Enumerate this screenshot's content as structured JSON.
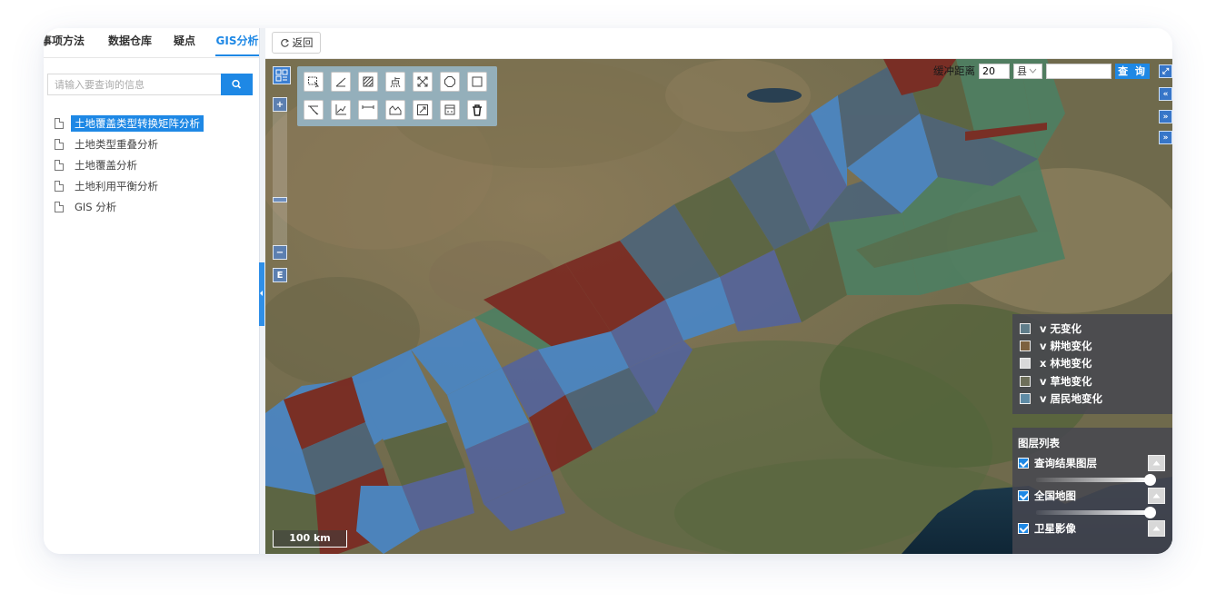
{
  "tabs": [
    {
      "label": "事项方法",
      "active": false
    },
    {
      "label": "数据仓库",
      "active": false
    },
    {
      "label": "疑点",
      "active": false
    },
    {
      "label": "GIS分析",
      "active": true
    }
  ],
  "search": {
    "placeholder": "请输入要查询的信息",
    "button_icon": "search-icon"
  },
  "tree": {
    "items": [
      {
        "label": "土地覆盖类型转换矩阵分析",
        "selected": true
      },
      {
        "label": "土地类型重叠分析",
        "selected": false
      },
      {
        "label": "土地覆盖分析",
        "selected": false
      },
      {
        "label": "土地利用平衡分析",
        "selected": false
      },
      {
        "label": "GIS 分析",
        "selected": false
      }
    ]
  },
  "topbar": {
    "back_label": "返回",
    "back_icon": "refresh-icon"
  },
  "map": {
    "buffer_label": "缓冲距离",
    "buffer_value": "20",
    "county_select": "县",
    "county_value": "",
    "query_label": "查 询",
    "scale_label": "100 km",
    "zoom_in": "+",
    "zoom_out": "−",
    "extent_label": "E",
    "side_buttons": [
      "⤢",
      "«",
      "»",
      "»"
    ],
    "tools": [
      "select-icon",
      "measure-line-icon",
      "hatch-area-icon",
      "point-tool-icon",
      "fit-extent-icon",
      "polygon-icon",
      "rectangle-icon",
      "clear-line-icon",
      "chart-axis-icon",
      "measure-distance-icon",
      "area-profile-icon",
      "zoom-frame-icon",
      "print-icon",
      "delete-icon"
    ],
    "point_tool_label": "点"
  },
  "legend": {
    "items": [
      {
        "label": "v 无变化",
        "color": "#5f7d8a"
      },
      {
        "label": "v 耕地变化",
        "color": "#7d6140"
      },
      {
        "label": "x 林地变化",
        "color": "#d9d9d9"
      },
      {
        "label": "v 草地变化",
        "color": "#6e6f5a"
      },
      {
        "label": "v 居民地变化",
        "color": "#5e8ba5"
      }
    ]
  },
  "layers": {
    "title": "图层列表",
    "items": [
      {
        "label": "查询结果图层",
        "checked": true,
        "opacity": 1.0
      },
      {
        "label": "全国地图",
        "checked": true,
        "opacity": 1.0
      },
      {
        "label": "卫星影像",
        "checked": true
      }
    ]
  },
  "colors": {
    "accent": "#1e88e5",
    "red_patch": "#7a2a22",
    "blue_patch": "#4a86c5",
    "green_patch": "#4e7f62",
    "olive_patch": "#5b6543",
    "slate_patch": "#4d6478",
    "purple_patch": "#55649a"
  }
}
